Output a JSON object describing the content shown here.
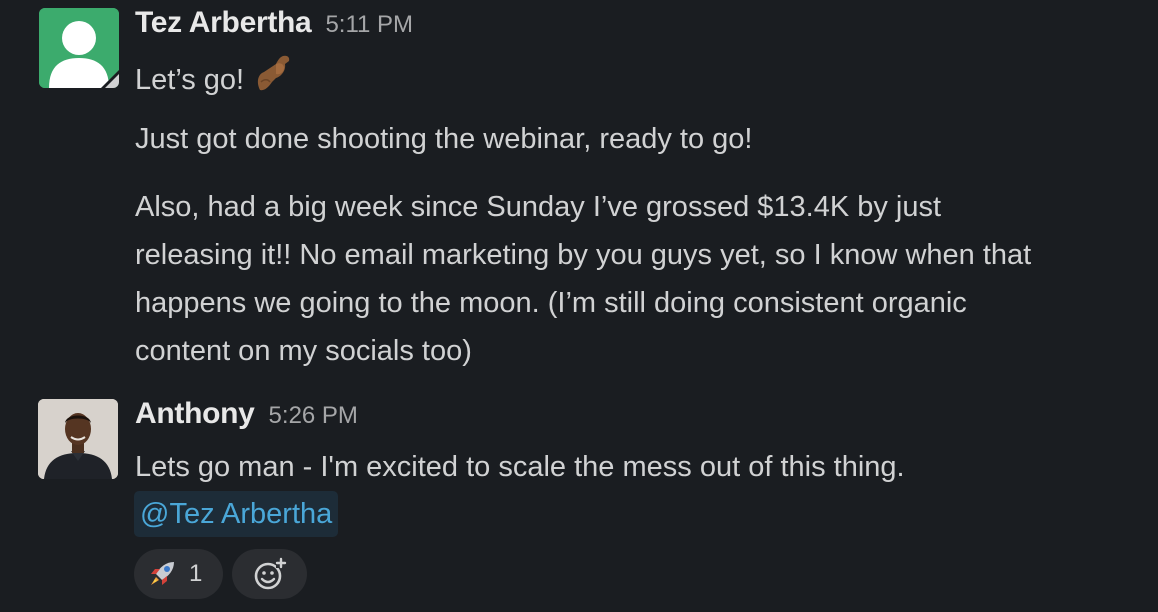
{
  "messages": [
    {
      "author": "Tez Arbertha",
      "time": "5:11 PM",
      "avatar_icon": "default-user-avatar-icon",
      "paragraphs": [
        "Let’s go!",
        "Just got done shooting the webinar, ready to go!",
        "Also, had a big week since Sunday I’ve grossed $13.4K by just",
        "releasing it!! No email marketing by you guys yet, so I know when that",
        "happens we going to the moon. (I’m still doing consistent organic",
        "content on my socials too)"
      ],
      "emoji": "flexed-biceps-icon"
    },
    {
      "author": "Anthony",
      "time": "5:26 PM",
      "avatar_icon": "profile-photo",
      "text": "Lets go man - I'm excited to scale the mess out of this thing.",
      "mention": "@Tez Arbertha",
      "reactions": [
        {
          "emoji": "rocket-icon",
          "count": "1"
        }
      ],
      "add_reaction_icon": "add-reaction-icon"
    }
  ],
  "colors": {
    "background": "#1a1d21",
    "text": "#d1d2d3",
    "timestamp": "#a5a6a8",
    "mention": "#4aa7d8",
    "mention_bg": "#1d2c38",
    "avatar_green": "#3cab6d"
  }
}
